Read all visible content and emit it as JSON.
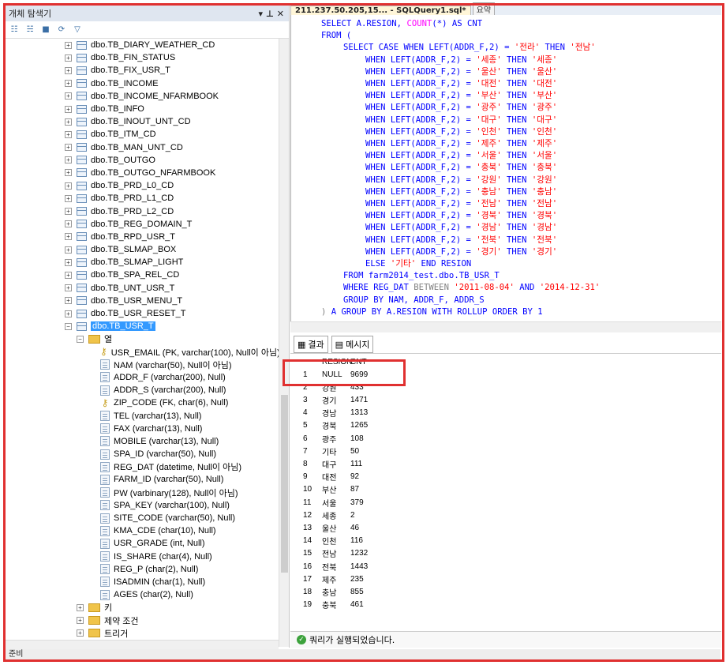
{
  "explorer": {
    "title": "개체 탐색기",
    "pin": "▾ ⊥ ✕",
    "tables": [
      "dbo.TB_DIARY_WEATHER_CD",
      "dbo.TB_FIN_STATUS",
      "dbo.TB_FIX_USR_T",
      "dbo.TB_INCOME",
      "dbo.TB_INCOME_NFARMBOOK",
      "dbo.TB_INFO",
      "dbo.TB_INOUT_UNT_CD",
      "dbo.TB_ITM_CD",
      "dbo.TB_MAN_UNT_CD",
      "dbo.TB_OUTGO",
      "dbo.TB_OUTGO_NFARMBOOK",
      "dbo.TB_PRD_L0_CD",
      "dbo.TB_PRD_L1_CD",
      "dbo.TB_PRD_L2_CD",
      "dbo.TB_REG_DOMAIN_T",
      "dbo.TB_RPD_USR_T",
      "dbo.TB_SLMAP_BOX",
      "dbo.TB_SLMAP_LIGHT",
      "dbo.TB_SPA_REL_CD",
      "dbo.TB_UNT_USR_T",
      "dbo.TB_USR_MENU_T",
      "dbo.TB_USR_RESET_T"
    ],
    "selected_table": "dbo.TB_USR_T",
    "columns_folder": "열",
    "columns": [
      {
        "name": "USR_EMAIL (PK, varchar(100), Null이 아님)",
        "key": true
      },
      {
        "name": "NAM (varchar(50), Null이 아님)",
        "key": false
      },
      {
        "name": "ADDR_F (varchar(200), Null)",
        "key": false
      },
      {
        "name": "ADDR_S (varchar(200), Null)",
        "key": false
      },
      {
        "name": "ZIP_CODE (FK, char(6), Null)",
        "key": true
      },
      {
        "name": "TEL (varchar(13), Null)",
        "key": false
      },
      {
        "name": "FAX (varchar(13), Null)",
        "key": false
      },
      {
        "name": "MOBILE (varchar(13), Null)",
        "key": false
      },
      {
        "name": "SPA_ID (varchar(50), Null)",
        "key": false
      },
      {
        "name": "REG_DAT (datetime, Null이 아님)",
        "key": false
      },
      {
        "name": "FARM_ID (varchar(50), Null)",
        "key": false
      },
      {
        "name": "PW (varbinary(128), Null이 아님)",
        "key": false
      },
      {
        "name": "SPA_KEY (varchar(100), Null)",
        "key": false
      },
      {
        "name": "SITE_CODE (varchar(50), Null)",
        "key": false
      },
      {
        "name": "KMA_CDE (char(10), Null)",
        "key": false
      },
      {
        "name": "USR_GRADE (int, Null)",
        "key": false
      },
      {
        "name": "IS_SHARE (char(4), Null)",
        "key": false
      },
      {
        "name": "REG_P (char(2), Null)",
        "key": false
      },
      {
        "name": "ISADMIN (char(1), Null)",
        "key": false
      },
      {
        "name": "AGES (char(2), Null)",
        "key": false
      }
    ],
    "folders_after": [
      "키",
      "제약 조건",
      "트리거"
    ]
  },
  "status_bar": "준비",
  "editor": {
    "tab_label": "211.237.50.205,15... - SQLQuery1.sql*",
    "tab2_label": "요약",
    "line1": "SELECT A.RESION, ",
    "line1_fn": "COUNT",
    "line1_rest": "(*) AS CNT",
    "line2": "FROM (",
    "case_first_left": "SELECT CASE WHEN LEFT(ADDR_F,2) = ",
    "when_prefix": "WHEN LEFT(ADDR_F,2) = ",
    "then_kw": " THEN ",
    "regions": [
      [
        "'전라'",
        "'전남'"
      ],
      [
        "'세종'",
        "'세종'"
      ],
      [
        "'울산'",
        "'울산'"
      ],
      [
        "'대전'",
        "'대전'"
      ],
      [
        "'부산'",
        "'부산'"
      ],
      [
        "'광주'",
        "'광주'"
      ],
      [
        "'대구'",
        "'대구'"
      ],
      [
        "'인천'",
        "'인천'"
      ],
      [
        "'제주'",
        "'제주'"
      ],
      [
        "'서울'",
        "'서울'"
      ],
      [
        "'충북'",
        "'충북'"
      ],
      [
        "'강원'",
        "'강원'"
      ],
      [
        "'충남'",
        "'충남'"
      ],
      [
        "'전남'",
        "'전남'"
      ],
      [
        "'경북'",
        "'경북'"
      ],
      [
        "'경남'",
        "'경남'"
      ],
      [
        "'전북'",
        "'전북'"
      ],
      [
        "'경기'",
        "'경기'"
      ]
    ],
    "else_kw": "ELSE ",
    "else_val": "'기타'",
    "end_kw": " END RESION",
    "from_line": "FROM farm2014_test.dbo.TB_USR_T",
    "where_kw": "WHERE REG_DAT ",
    "between_kw": "BETWEEN ",
    "date1": "'2011-08-04'",
    "and_kw": " AND ",
    "date2": "'2014-12-31'",
    "group_line": "GROUP BY NAM, ADDR_F, ADDR_S",
    "final_paren": ") ",
    "final_line": "A GROUP BY A.RESION WITH ROLLUP ORDER BY 1"
  },
  "results": {
    "tab_results": "결과",
    "tab_messages": "메시지",
    "col_resion": "RESION",
    "col_cnt": "CNT",
    "rows": [
      [
        "1",
        "NULL",
        "9699"
      ],
      [
        "2",
        "강원",
        "433"
      ],
      [
        "3",
        "경기",
        "1471"
      ],
      [
        "4",
        "경남",
        "1313"
      ],
      [
        "5",
        "경북",
        "1265"
      ],
      [
        "6",
        "광주",
        "108"
      ],
      [
        "7",
        "기타",
        "50"
      ],
      [
        "8",
        "대구",
        "111"
      ],
      [
        "9",
        "대전",
        "92"
      ],
      [
        "10",
        "부산",
        "87"
      ],
      [
        "11",
        "서울",
        "379"
      ],
      [
        "12",
        "세종",
        "2"
      ],
      [
        "13",
        "울산",
        "46"
      ],
      [
        "14",
        "인천",
        "116"
      ],
      [
        "15",
        "전남",
        "1232"
      ],
      [
        "16",
        "전북",
        "1443"
      ],
      [
        "17",
        "제주",
        "235"
      ],
      [
        "18",
        "충남",
        "855"
      ],
      [
        "19",
        "충북",
        "461"
      ]
    ],
    "status": "쿼리가 실행되었습니다."
  }
}
